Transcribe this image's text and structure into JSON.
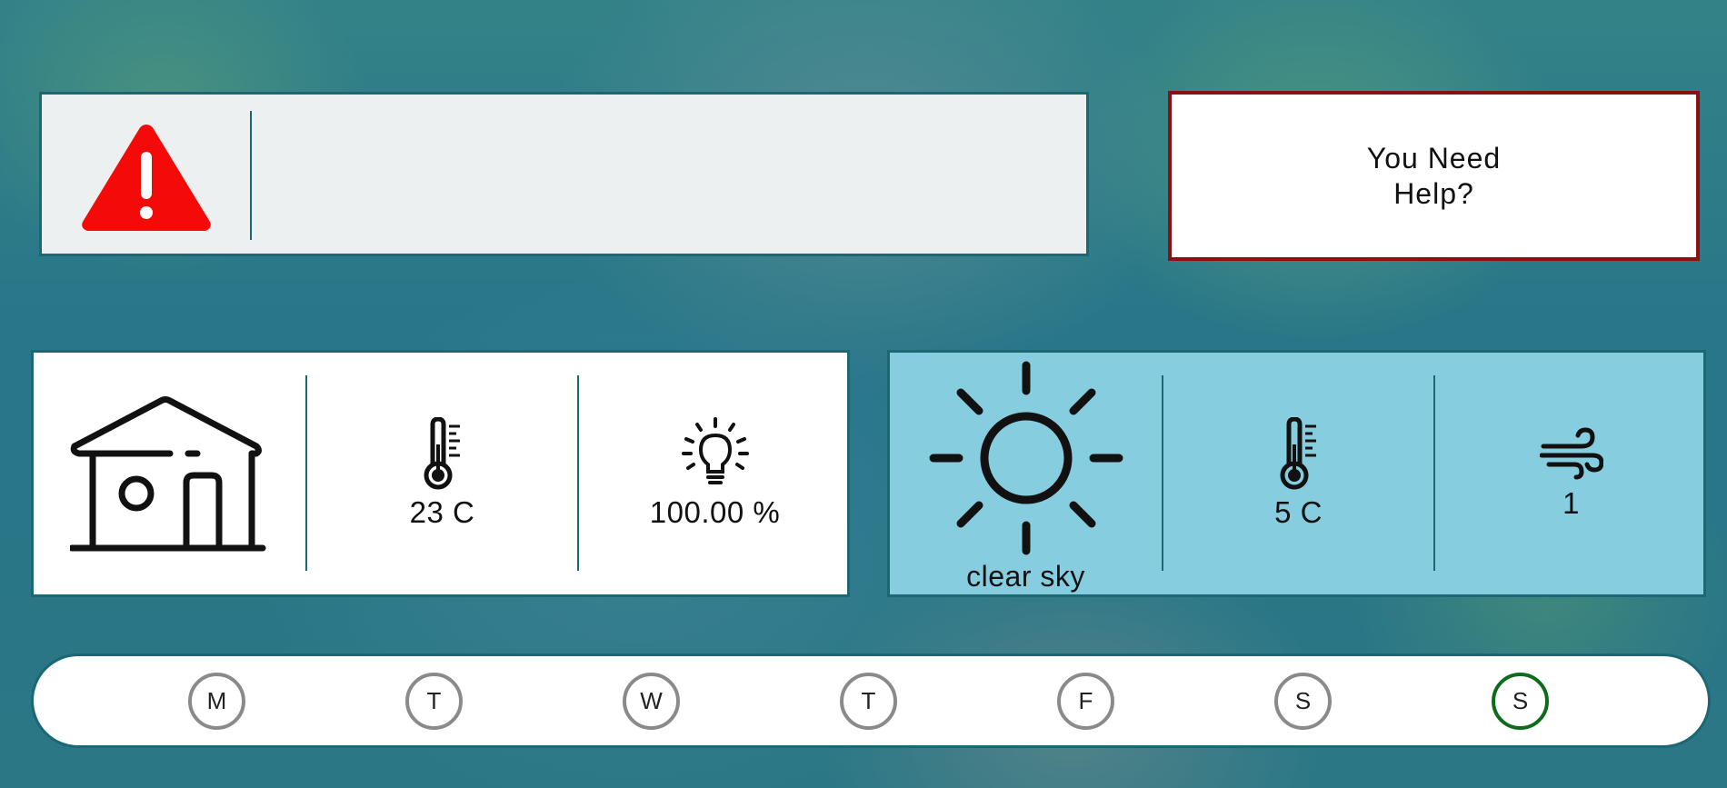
{
  "alert": {
    "icon": "warning-icon",
    "icon_color": "#f50a0a",
    "message": ""
  },
  "help": {
    "label": "You Need Help?",
    "border_color": "#8c1010"
  },
  "home": {
    "icon": "house-icon",
    "temperature_icon": "thermometer-icon",
    "temperature": "23 C",
    "light_icon": "lightbulb-icon",
    "light": "100.00 %"
  },
  "weather": {
    "icon": "sun-icon",
    "description": "clear sky",
    "temperature_icon": "thermometer-icon",
    "temperature": "5 C",
    "wind_icon": "wind-icon",
    "wind": "1",
    "background": "#86cddf"
  },
  "days": [
    {
      "label": "M",
      "active": false
    },
    {
      "label": "T",
      "active": false
    },
    {
      "label": "W",
      "active": false
    },
    {
      "label": "T",
      "active": false
    },
    {
      "label": "F",
      "active": false
    },
    {
      "label": "S",
      "active": false
    },
    {
      "label": "S",
      "active": true
    }
  ],
  "colors": {
    "accent": "#1b6774",
    "active_day": "#0e6b1c",
    "inactive_day": "#8a8a8a"
  }
}
